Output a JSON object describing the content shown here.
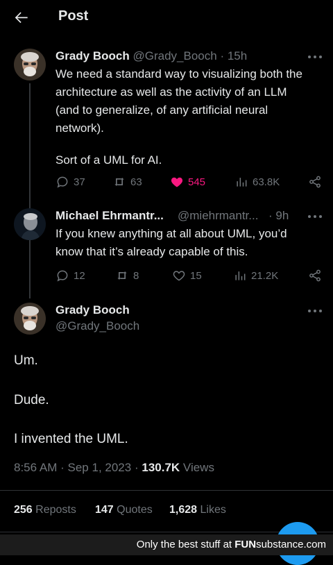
{
  "header": {
    "title": "Post"
  },
  "post1": {
    "name": "Grady Booch",
    "handle": "@Grady_Booch",
    "dot": "·",
    "time": "15h",
    "text_1": "We need a standard way to visualizing both the",
    "text_2": "architecture as well as the activity of an LLM",
    "text_3": "(and to generalize, of any artificial neural",
    "text_4": "network).",
    "text_5": "Sort of a UML for AI.",
    "replies": "37",
    "reposts": "63",
    "likes": "545",
    "views": "63.8K",
    "like_color": "#f91880"
  },
  "post2": {
    "name": "Michael Ehrmantr...",
    "handle": "@miehrmantr...",
    "dot": "·",
    "time": "9h",
    "text_1": "If you knew anything at all about UML, you’d",
    "text_2": "know that it’s already capable of this.",
    "replies": "12",
    "reposts": "8",
    "likes": "15",
    "views": "21.2K"
  },
  "main": {
    "name": "Grady Booch",
    "handle": "@Grady_Booch",
    "line_1": "Um.",
    "line_2": "Dude.",
    "line_3": "I invented the UML.",
    "time": "8:56 AM",
    "dot1": "·",
    "date": "Sep 1, 2023",
    "dot2": "·",
    "views_count": "130.7K",
    "views_label": "Views",
    "reposts_count": "256",
    "reposts_label": "Reposts",
    "quotes_count": "147",
    "quotes_label": "Quotes",
    "likes_count": "1,628",
    "likes_label": "Likes"
  },
  "accent": "#1d9bf0",
  "icons": [
    "back-arrow-icon",
    "more-icon",
    "reply-icon",
    "repost-icon",
    "heart-icon",
    "views-icon",
    "share-icon"
  ],
  "watermark": {
    "prefix": "Only the best stuff at ",
    "brand_a": "FUN",
    "brand_b": "substance",
    "brand_c": ".com"
  }
}
